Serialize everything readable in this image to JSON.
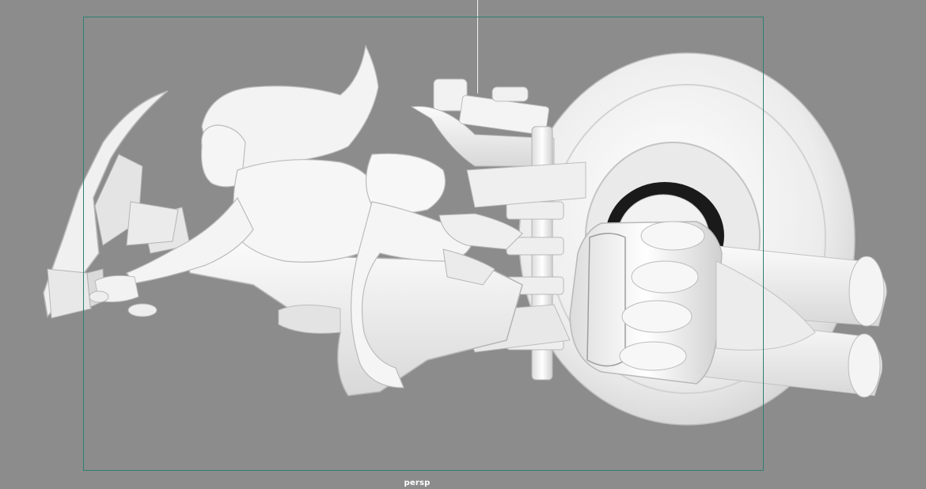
{
  "viewport": {
    "camera_label": "persp",
    "background_color": "#8c8c8c",
    "resolution_gate_color": "#2f7f73",
    "model_color": "#f0f0f0"
  },
  "scene": {
    "subject": "3d-model-woman-on-jet-hoverbike"
  }
}
